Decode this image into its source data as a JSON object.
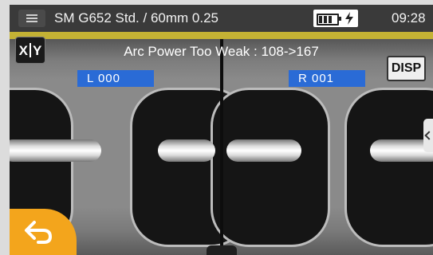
{
  "header": {
    "title": "SM G652 Std. / 60mm 0.25",
    "time": "09:28",
    "battery_icon": "battery-charging-icon"
  },
  "message": "Arc Power Too Weak : 108->167",
  "buttons": {
    "xy_left": "X",
    "xy_right": "Y",
    "disp": "DISP"
  },
  "views": {
    "left_label": "L  000",
    "right_label": "R  001"
  },
  "colors": {
    "banner": "#c4b234",
    "label_blue": "#2a6bd6",
    "back_orange": "#f3a51c"
  },
  "icons": [
    "menu-icon",
    "battery-charging-icon",
    "back-arrow-icon",
    "chevron-left-icon"
  ]
}
